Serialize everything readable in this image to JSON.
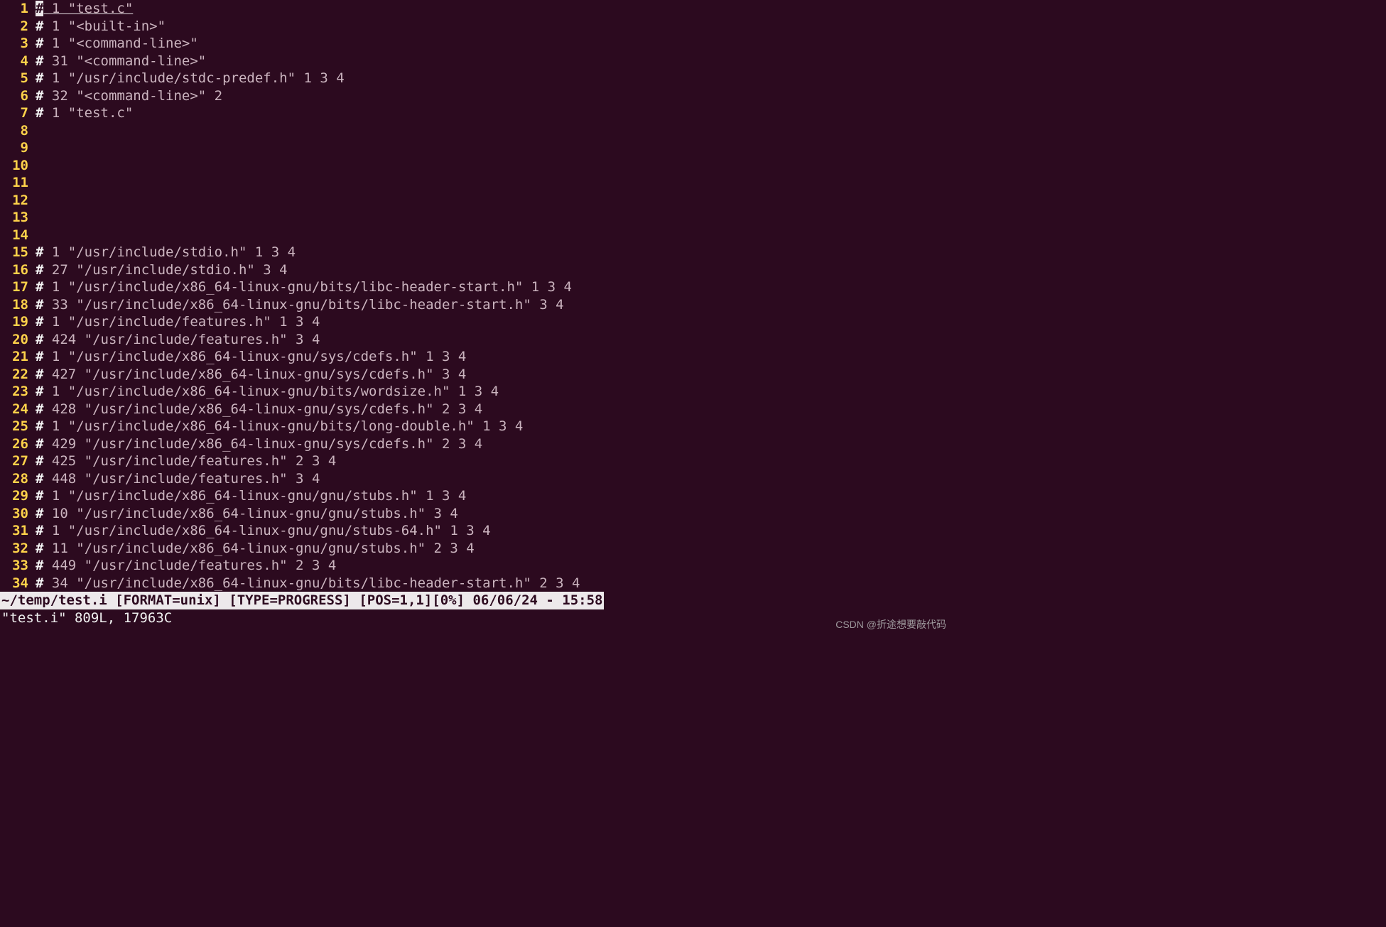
{
  "lines": [
    {
      "n": "1",
      "hash": "#",
      "cursor_on_hash": true,
      "rest": " 1 \"test.c\"",
      "underline": true
    },
    {
      "n": "2",
      "hash": "#",
      "rest": " 1 \"<built-in>\""
    },
    {
      "n": "3",
      "hash": "#",
      "rest": " 1 \"<command-line>\""
    },
    {
      "n": "4",
      "hash": "#",
      "rest": " 31 \"<command-line>\""
    },
    {
      "n": "5",
      "hash": "#",
      "rest": " 1 \"/usr/include/stdc-predef.h\" 1 3 4"
    },
    {
      "n": "6",
      "hash": "#",
      "rest": " 32 \"<command-line>\" 2"
    },
    {
      "n": "7",
      "hash": "#",
      "rest": " 1 \"test.c\""
    },
    {
      "n": "8",
      "hash": "",
      "rest": ""
    },
    {
      "n": "9",
      "hash": "",
      "rest": ""
    },
    {
      "n": "10",
      "hash": "",
      "rest": ""
    },
    {
      "n": "11",
      "hash": "",
      "rest": ""
    },
    {
      "n": "12",
      "hash": "",
      "rest": ""
    },
    {
      "n": "13",
      "hash": "",
      "rest": ""
    },
    {
      "n": "14",
      "hash": "",
      "rest": ""
    },
    {
      "n": "15",
      "hash": "#",
      "rest": " 1 \"/usr/include/stdio.h\" 1 3 4"
    },
    {
      "n": "16",
      "hash": "#",
      "rest": " 27 \"/usr/include/stdio.h\" 3 4"
    },
    {
      "n": "17",
      "hash": "#",
      "rest": " 1 \"/usr/include/x86_64-linux-gnu/bits/libc-header-start.h\" 1 3 4"
    },
    {
      "n": "18",
      "hash": "#",
      "rest": " 33 \"/usr/include/x86_64-linux-gnu/bits/libc-header-start.h\" 3 4"
    },
    {
      "n": "19",
      "hash": "#",
      "rest": " 1 \"/usr/include/features.h\" 1 3 4"
    },
    {
      "n": "20",
      "hash": "#",
      "rest": " 424 \"/usr/include/features.h\" 3 4"
    },
    {
      "n": "21",
      "hash": "#",
      "rest": " 1 \"/usr/include/x86_64-linux-gnu/sys/cdefs.h\" 1 3 4"
    },
    {
      "n": "22",
      "hash": "#",
      "rest": " 427 \"/usr/include/x86_64-linux-gnu/sys/cdefs.h\" 3 4"
    },
    {
      "n": "23",
      "hash": "#",
      "rest": " 1 \"/usr/include/x86_64-linux-gnu/bits/wordsize.h\" 1 3 4"
    },
    {
      "n": "24",
      "hash": "#",
      "rest": " 428 \"/usr/include/x86_64-linux-gnu/sys/cdefs.h\" 2 3 4"
    },
    {
      "n": "25",
      "hash": "#",
      "rest": " 1 \"/usr/include/x86_64-linux-gnu/bits/long-double.h\" 1 3 4"
    },
    {
      "n": "26",
      "hash": "#",
      "rest": " 429 \"/usr/include/x86_64-linux-gnu/sys/cdefs.h\" 2 3 4"
    },
    {
      "n": "27",
      "hash": "#",
      "rest": " 425 \"/usr/include/features.h\" 2 3 4"
    },
    {
      "n": "28",
      "hash": "#",
      "rest": " 448 \"/usr/include/features.h\" 3 4"
    },
    {
      "n": "29",
      "hash": "#",
      "rest": " 1 \"/usr/include/x86_64-linux-gnu/gnu/stubs.h\" 1 3 4"
    },
    {
      "n": "30",
      "hash": "#",
      "rest": " 10 \"/usr/include/x86_64-linux-gnu/gnu/stubs.h\" 3 4"
    },
    {
      "n": "31",
      "hash": "#",
      "rest": " 1 \"/usr/include/x86_64-linux-gnu/gnu/stubs-64.h\" 1 3 4"
    },
    {
      "n": "32",
      "hash": "#",
      "rest": " 11 \"/usr/include/x86_64-linux-gnu/gnu/stubs.h\" 2 3 4"
    },
    {
      "n": "33",
      "hash": "#",
      "rest": " 449 \"/usr/include/features.h\" 2 3 4"
    },
    {
      "n": "34",
      "hash": "#",
      "rest": " 34 \"/usr/include/x86_64-linux-gnu/bits/libc-header-start.h\" 2 3 4"
    }
  ],
  "status_bar": "~/temp/test.i [FORMAT=unix] [TYPE=PROGRESS] [POS=1,1][0%] 06/06/24 - 15:58",
  "cmd_line": "\"test.i\" 809L, 17963C",
  "watermark": "CSDN @折途想要敲代码"
}
